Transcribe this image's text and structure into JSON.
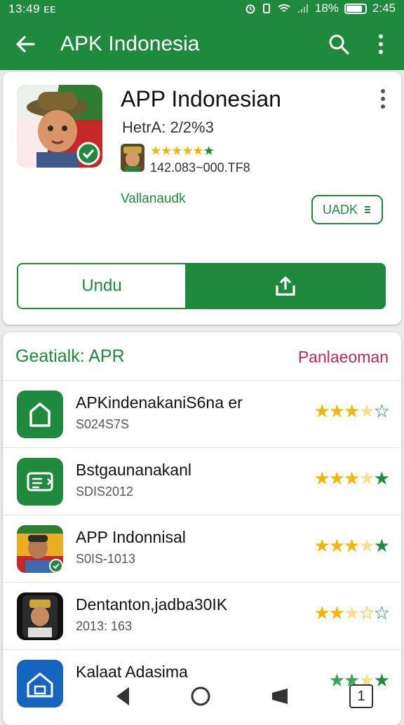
{
  "status_bar": {
    "time": "13:49",
    "carrier": "ᴇᴇ",
    "battery_label": "18%",
    "clock_right": "2:45"
  },
  "app_bar": {
    "title": "APK Indonesia",
    "back_icon": "arrow-left-icon",
    "search_icon": "search-icon",
    "menu_icon": "more-vert-icon"
  },
  "app_card": {
    "title": "APP Indonesian",
    "meta": "HetrA:   2/2%3",
    "rating_stars": 5,
    "downloads": "142.083~000.TF8",
    "verified": "Vallanaudk",
    "uadk_button": "UADK",
    "download_button": "Undu",
    "share_icon": "share-upload-icon",
    "menu_icon": "more-vert-icon"
  },
  "section": {
    "title": "Geatialk: APR",
    "link": "Panlaeoman",
    "items": [
      {
        "name": "APKindenakaniS6na er",
        "sub": "S024S7S",
        "rating": 3.5,
        "icon": "home-app-icon"
      },
      {
        "name": "Bstgaunanakanl",
        "sub": "SDIS2012",
        "rating": 3.5,
        "icon": "list-app-icon"
      },
      {
        "name": "APP Indonnisal",
        "sub": "S0IS-1013",
        "rating": 3.5,
        "icon": "avatar-app-icon"
      },
      {
        "name": "Dentanton,jadba30IK",
        "sub": "2013: 163",
        "rating": 2.5,
        "icon": "portrait-app-icon"
      },
      {
        "name": "Kalaat Adasima",
        "sub": "",
        "rating": 3,
        "icon": "building-app-icon"
      }
    ]
  },
  "nav_bar": {
    "recent_badge": "1",
    "back_icon": "nav-back-icon",
    "home_icon": "nav-home-icon",
    "shape_icon": "nav-shape-icon"
  },
  "colors": {
    "primary": "#1f8a3e",
    "accent_link": "#c0285a",
    "star": "#f2b705"
  }
}
